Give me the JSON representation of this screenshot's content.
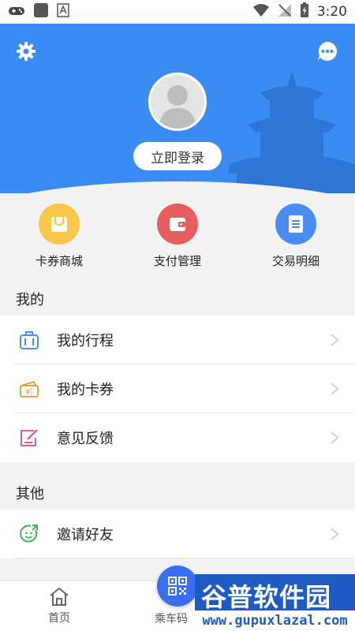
{
  "status_bar": {
    "time": "3:20",
    "icons": [
      "gamepad-icon",
      "square-icon",
      "a-icon",
      "wifi-icon",
      "no-signal-icon",
      "battery-charging-icon"
    ]
  },
  "header": {
    "login_label": "立即登录",
    "background_color": "#3a8bf2",
    "icons": [
      "settings-icon",
      "message-icon"
    ]
  },
  "quick_actions": [
    {
      "label": "卡券商城",
      "icon": "shopping-bag-icon",
      "color": "#f8c64a"
    },
    {
      "label": "支付管理",
      "icon": "wallet-icon",
      "color": "#e85d5d"
    },
    {
      "label": "交易明细",
      "icon": "document-icon",
      "color": "#4a8cf2"
    }
  ],
  "sections": {
    "mine_title": "我的",
    "mine_items": [
      {
        "label": "我的行程",
        "icon": "luggage-icon",
        "color": "#4a8cf2"
      },
      {
        "label": "我的卡券",
        "icon": "ticket-icon",
        "color": "#e8962e"
      },
      {
        "label": "意见反馈",
        "icon": "feedback-edit-icon",
        "color": "#d94b8c"
      }
    ],
    "other_title": "其他",
    "other_items": [
      {
        "label": "邀请好友",
        "icon": "invite-smile-icon",
        "color": "#3bb55a"
      }
    ]
  },
  "bottom_nav": {
    "home_label": "首页",
    "qr_label": "乘车码"
  },
  "watermark": {
    "title": "谷普软件园",
    "url": "www.gupuxlazal.com"
  }
}
